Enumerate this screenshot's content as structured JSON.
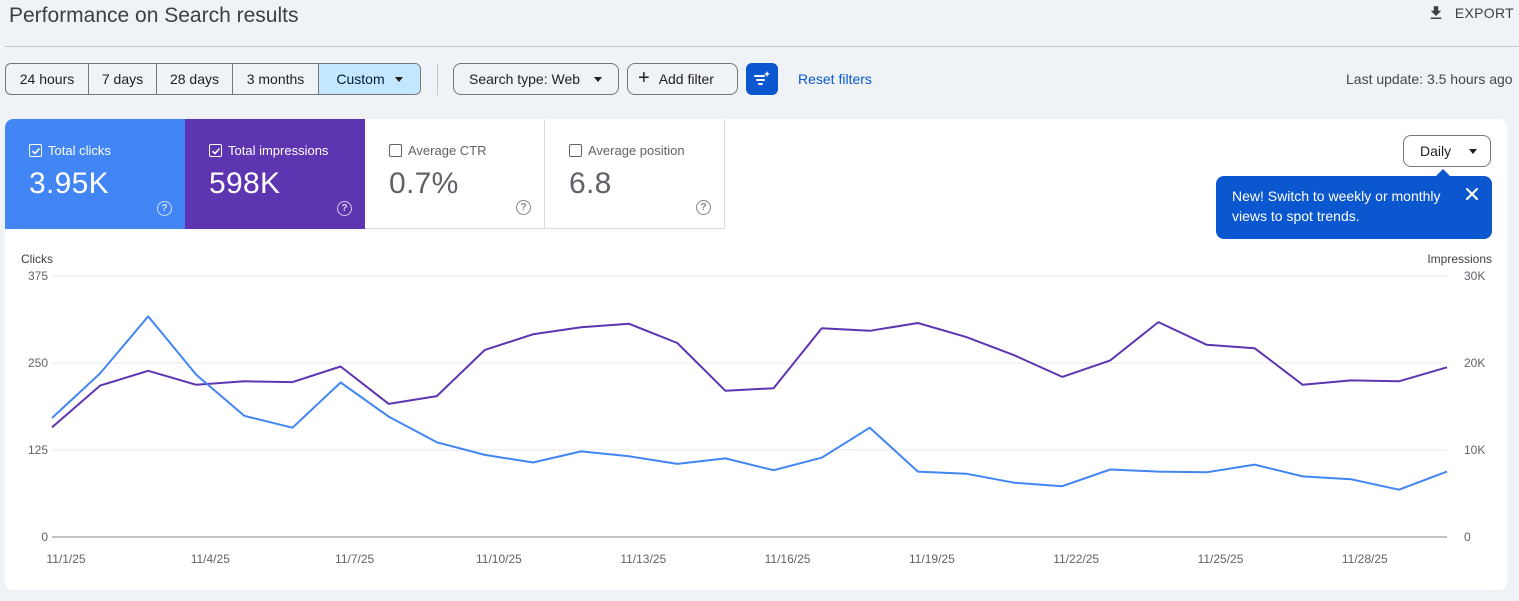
{
  "header": {
    "title": "Performance on Search results",
    "export_label": "EXPORT"
  },
  "toolbar": {
    "date_ranges": [
      "24 hours",
      "7 days",
      "28 days",
      "3 months",
      "Custom"
    ],
    "selected_range": "Custom",
    "search_type_label": "Search type: Web",
    "add_filter_label": "Add filter",
    "reset_filters_label": "Reset filters",
    "last_update": "Last update: 3.5 hours ago"
  },
  "metrics": [
    {
      "label": "Total clicks",
      "value": "3.95K",
      "checked": true,
      "color": "#4285f4"
    },
    {
      "label": "Total impressions",
      "value": "598K",
      "checked": true,
      "color": "#5e35b1"
    },
    {
      "label": "Average CTR",
      "value": "0.7%",
      "checked": false
    },
    {
      "label": "Average position",
      "value": "6.8",
      "checked": false
    }
  ],
  "granularity": {
    "selected": "Daily"
  },
  "tooltip": {
    "text": "New! Switch to weekly or monthly views to spot trends."
  },
  "chart_data": {
    "type": "line",
    "left_axis": {
      "title": "Clicks",
      "ticks": [
        "0",
        "125",
        "250",
        "375"
      ],
      "range": [
        0,
        375
      ]
    },
    "right_axis": {
      "title": "Impressions",
      "ticks": [
        "0",
        "10K",
        "20K",
        "30K"
      ],
      "range": [
        0,
        30000
      ]
    },
    "x_ticks": [
      "11/1/25",
      "11/4/25",
      "11/7/25",
      "11/10/25",
      "11/13/25",
      "11/16/25",
      "11/19/25",
      "11/22/25",
      "11/25/25",
      "11/28/25"
    ],
    "x": [
      "11/1/25",
      "11/2/25",
      "11/3/25",
      "11/4/25",
      "11/5/25",
      "11/6/25",
      "11/7/25",
      "11/8/25",
      "11/9/25",
      "11/10/25",
      "11/11/25",
      "11/12/25",
      "11/13/25",
      "11/14/25",
      "11/15/25",
      "11/16/25",
      "11/17/25",
      "11/18/25",
      "11/19/25",
      "11/20/25",
      "11/21/25",
      "11/22/25",
      "11/23/25",
      "11/24/25",
      "11/25/25",
      "11/26/25",
      "11/27/25",
      "11/28/25",
      "11/29/25",
      "11/30/25"
    ],
    "grid": true,
    "series": [
      {
        "name": "Clicks",
        "axis": "left",
        "color": "#4285f4",
        "values": [
          171,
          235,
          317,
          233,
          174,
          157,
          222,
          173,
          136,
          118,
          107,
          123,
          116,
          105,
          113,
          96,
          114,
          157,
          94,
          91,
          78,
          73,
          97,
          94,
          93,
          104,
          87,
          83,
          68,
          94
        ]
      },
      {
        "name": "Impressions",
        "axis": "right",
        "color": "#5e35b1",
        "values": [
          12600,
          17400,
          19100,
          17500,
          17900,
          17800,
          19600,
          15300,
          16200,
          21500,
          23300,
          24100,
          24500,
          22300,
          16800,
          17100,
          24000,
          23700,
          24600,
          23000,
          20900,
          18400,
          20300,
          24700,
          22100,
          21700,
          17500,
          18000,
          17900,
          19500
        ]
      }
    ]
  }
}
